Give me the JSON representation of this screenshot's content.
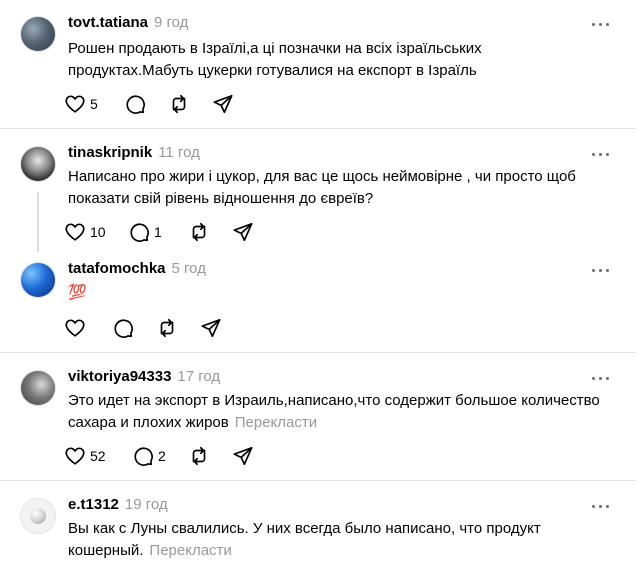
{
  "comments": [
    {
      "username": "tovt.tatiana",
      "time": "9 год",
      "text": "Рошен продають в Ізраїлі,а ці позначки на всіх ізраїльських продуктах.Мабуть цукерки готувалися на експорт в Ізраїль",
      "likes": "5",
      "replies": ""
    },
    {
      "username": "tinaskripnik",
      "time": "11 год",
      "text": "Написано про жири і цукор, для вас це щось неймовірне , чи просто щоб показати свій рівень відношення до євреїв?",
      "likes": "10",
      "replies": "1"
    },
    {
      "username": "tatafomochka",
      "time": "5 год",
      "text": "💯",
      "likes": "",
      "replies": ""
    },
    {
      "username": "viktoriya94333",
      "time": "17 год",
      "text": "Это идет на экспорт в Израиль,написано,что содержит большое количество сахара и плохих жиров",
      "translate": "Перекласти",
      "likes": "52",
      "replies": "2"
    },
    {
      "username": "e.t1312",
      "time": "19 год",
      "text": "Вы как с Луны свалились. У них всегда было написано, что продукт кошерный.",
      "translate": "Перекласти"
    }
  ]
}
